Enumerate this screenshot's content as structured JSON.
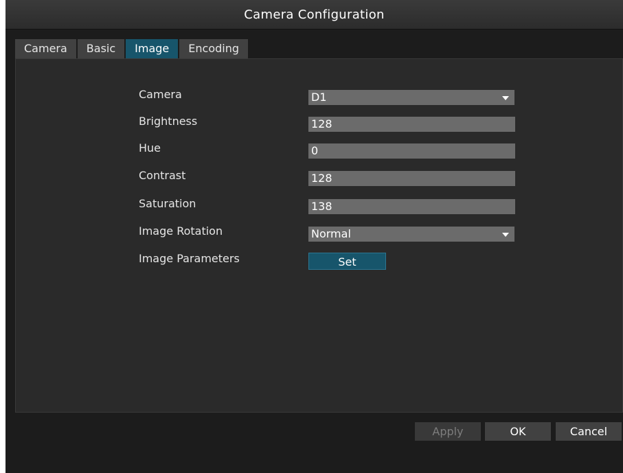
{
  "window": {
    "title": "Camera Configuration"
  },
  "tabs": [
    {
      "label": "Camera",
      "active": false
    },
    {
      "label": "Basic",
      "active": false
    },
    {
      "label": "Image",
      "active": true
    },
    {
      "label": "Encoding",
      "active": false
    }
  ],
  "form": {
    "camera": {
      "label": "Camera",
      "value": "D1"
    },
    "brightness": {
      "label": "Brightness",
      "value": "128"
    },
    "hue": {
      "label": "Hue",
      "value": "0"
    },
    "contrast": {
      "label": "Contrast",
      "value": "128"
    },
    "saturation": {
      "label": "Saturation",
      "value": "138"
    },
    "image_rotation": {
      "label": "Image Rotation",
      "value": "Normal"
    },
    "image_parameters": {
      "label": "Image Parameters",
      "button_label": "Set"
    }
  },
  "footer": {
    "apply_label": "Apply",
    "ok_label": "OK",
    "cancel_label": "Cancel"
  },
  "colors": {
    "accent": "#17556b",
    "background": "#1c1c1c",
    "panel": "#2a2a2a",
    "field": "#6b6b6b"
  },
  "icons": {
    "dropdown": "chevron-down-icon"
  }
}
